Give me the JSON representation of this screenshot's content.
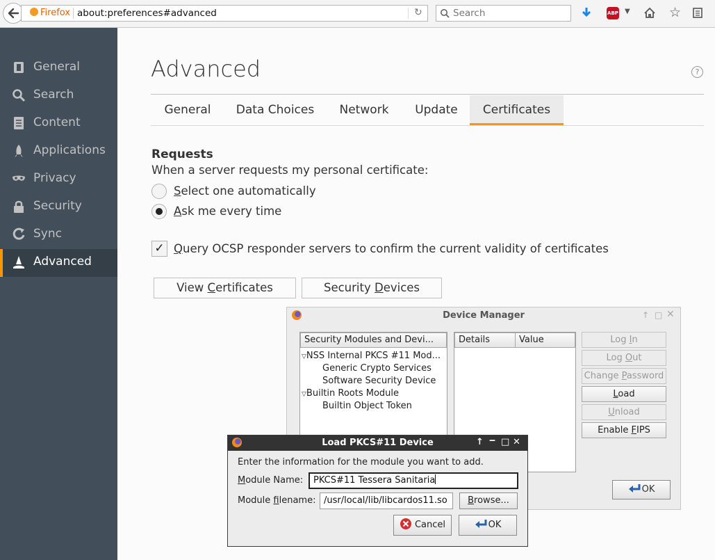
{
  "toolbar": {
    "identity_label": "Firefox",
    "url": "about:preferences#advanced",
    "search_placeholder": "Search",
    "adblock_label": "ABP"
  },
  "sidebar": {
    "items": [
      {
        "label": "General",
        "icon": "general-icon"
      },
      {
        "label": "Search",
        "icon": "search-icon"
      },
      {
        "label": "Content",
        "icon": "content-icon"
      },
      {
        "label": "Applications",
        "icon": "applications-icon"
      },
      {
        "label": "Privacy",
        "icon": "privacy-mask-icon"
      },
      {
        "label": "Security",
        "icon": "security-lock-icon"
      },
      {
        "label": "Sync",
        "icon": "sync-icon"
      },
      {
        "label": "Advanced",
        "icon": "advanced-wizard-icon",
        "selected": true
      }
    ]
  },
  "main": {
    "title": "Advanced",
    "help_glyph": "?",
    "tabs": [
      {
        "label": "General"
      },
      {
        "label": "Data Choices"
      },
      {
        "label": "Network"
      },
      {
        "label": "Update"
      },
      {
        "label": "Certificates",
        "selected": true
      }
    ],
    "requests_heading": "Requests",
    "requests_desc": "When a server requests my personal certificate:",
    "option_auto": "elect one automatically",
    "option_auto_key": "S",
    "option_ask": "sk me every time",
    "option_ask_key": "A",
    "ocsp_label_key": "Q",
    "ocsp_label": "uery OCSP responder servers to confirm the current validity of certificates",
    "view_certs_pre": "View ",
    "view_certs_key": "C",
    "view_certs_post": "ertificates",
    "sec_devices_pre": "Security ",
    "sec_devices_key": "D",
    "sec_devices_post": "evices"
  },
  "device_manager": {
    "title": "Device Manager",
    "tree_header": "Security Modules and Devi...",
    "tree": [
      {
        "label": "NSS Internal PKCS #11 Mod...",
        "level": 0
      },
      {
        "label": "Generic Crypto Services",
        "level": 1
      },
      {
        "label": "Software Security Device",
        "level": 1
      },
      {
        "label": "Builtin Roots Module",
        "level": 0
      },
      {
        "label": "Builtin Object Token",
        "level": 1
      }
    ],
    "col_details": "Details",
    "col_value": "Value",
    "btn_login_pre": "Log ",
    "btn_login_key": "I",
    "btn_login_post": "n",
    "btn_logout_pre": "Log ",
    "btn_logout_key": "O",
    "btn_logout_post": "ut",
    "btn_changepw_pre": "Change ",
    "btn_changepw_key": "P",
    "btn_changepw_post": "assword",
    "btn_load_key": "L",
    "btn_load_post": "oad",
    "btn_unload_key": "U",
    "btn_unload_post": "nload",
    "btn_fips_pre": "Enable ",
    "btn_fips_key": "F",
    "btn_fips_post": "IPS",
    "ok_label": "OK"
  },
  "load_dialog": {
    "title": "Load PKCS#11 Device",
    "info": "Enter the information for the module you want to add.",
    "module_name_key": "M",
    "module_name_label": "odule Name:",
    "module_name_value": "PKCS#11 Tessera Sanitaria",
    "module_file_pre": "Module ",
    "module_file_key": "f",
    "module_file_post": "ilename:",
    "module_file_value": "/usr/local/lib/libcardos11.so",
    "browse_key": "B",
    "browse_post": "rowse...",
    "cancel_label": "Cancel",
    "ok_label": "OK"
  }
}
